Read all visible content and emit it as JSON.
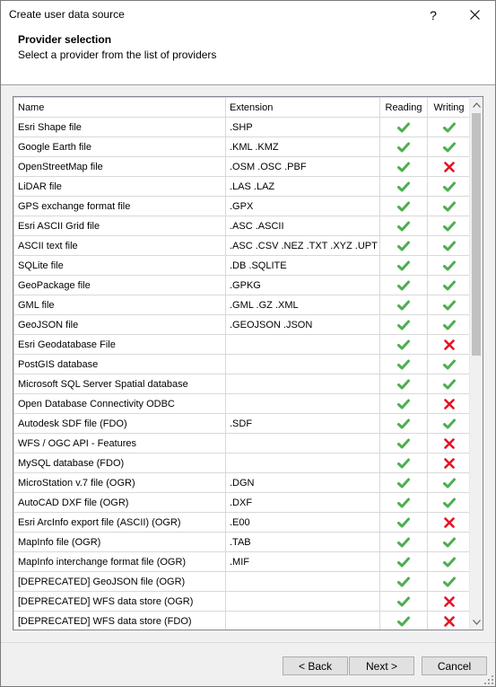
{
  "window": {
    "title": "Create user data source",
    "help_label": "?",
    "close_label": "✕"
  },
  "header": {
    "title": "Provider selection",
    "subtitle": "Select a provider from the list of providers"
  },
  "table": {
    "columns": {
      "name": "Name",
      "extension": "Extension",
      "reading": "Reading",
      "writing": "Writing"
    },
    "rows": [
      {
        "name": "Esri Shape file",
        "extension": ".SHP",
        "reading": true,
        "writing": true
      },
      {
        "name": "Google Earth file",
        "extension": ".KML .KMZ",
        "reading": true,
        "writing": true
      },
      {
        "name": "OpenStreetMap file",
        "extension": ".OSM .OSC .PBF",
        "reading": true,
        "writing": false
      },
      {
        "name": "LiDAR file",
        "extension": ".LAS .LAZ",
        "reading": true,
        "writing": true
      },
      {
        "name": "GPS exchange format file",
        "extension": ".GPX",
        "reading": true,
        "writing": true
      },
      {
        "name": "Esri ASCII Grid file",
        "extension": ".ASC .ASCII",
        "reading": true,
        "writing": true
      },
      {
        "name": "ASCII text file",
        "extension": ".ASC .CSV .NEZ .TXT .XYZ .UPT",
        "reading": true,
        "writing": true
      },
      {
        "name": "SQLite file",
        "extension": ".DB .SQLITE",
        "reading": true,
        "writing": true
      },
      {
        "name": "GeoPackage file",
        "extension": ".GPKG",
        "reading": true,
        "writing": true
      },
      {
        "name": "GML file",
        "extension": ".GML .GZ .XML",
        "reading": true,
        "writing": true
      },
      {
        "name": "GeoJSON file",
        "extension": ".GEOJSON .JSON",
        "reading": true,
        "writing": true
      },
      {
        "name": "Esri Geodatabase File",
        "extension": "",
        "reading": true,
        "writing": false
      },
      {
        "name": "PostGIS database",
        "extension": "",
        "reading": true,
        "writing": true
      },
      {
        "name": "Microsoft SQL Server Spatial database",
        "extension": "",
        "reading": true,
        "writing": true
      },
      {
        "name": "Open Database Connectivity ODBC",
        "extension": "",
        "reading": true,
        "writing": false
      },
      {
        "name": "Autodesk SDF file (FDO)",
        "extension": ".SDF",
        "reading": true,
        "writing": true
      },
      {
        "name": "WFS / OGC API - Features",
        "extension": "",
        "reading": true,
        "writing": false
      },
      {
        "name": "MySQL database (FDO)",
        "extension": "",
        "reading": true,
        "writing": false
      },
      {
        "name": "MicroStation v.7 file (OGR)",
        "extension": ".DGN",
        "reading": true,
        "writing": true
      },
      {
        "name": "AutoCAD DXF file (OGR)",
        "extension": ".DXF",
        "reading": true,
        "writing": true
      },
      {
        "name": "Esri ArcInfo export file (ASCII) (OGR)",
        "extension": ".E00",
        "reading": true,
        "writing": false
      },
      {
        "name": "MapInfo file (OGR)",
        "extension": ".TAB",
        "reading": true,
        "writing": true
      },
      {
        "name": "MapInfo interchange format file (OGR)",
        "extension": ".MIF",
        "reading": true,
        "writing": true
      },
      {
        "name": "[DEPRECATED] GeoJSON file (OGR)",
        "extension": "",
        "reading": true,
        "writing": true
      },
      {
        "name": "[DEPRECATED] WFS data store (OGR)",
        "extension": "",
        "reading": true,
        "writing": false
      },
      {
        "name": "[DEPRECATED] WFS data store (FDO)",
        "extension": "",
        "reading": true,
        "writing": false
      }
    ]
  },
  "buttons": {
    "back": "< Back",
    "next": "Next >",
    "cancel": "Cancel"
  },
  "colors": {
    "check": "#4caf50",
    "cross": "#e81123"
  }
}
